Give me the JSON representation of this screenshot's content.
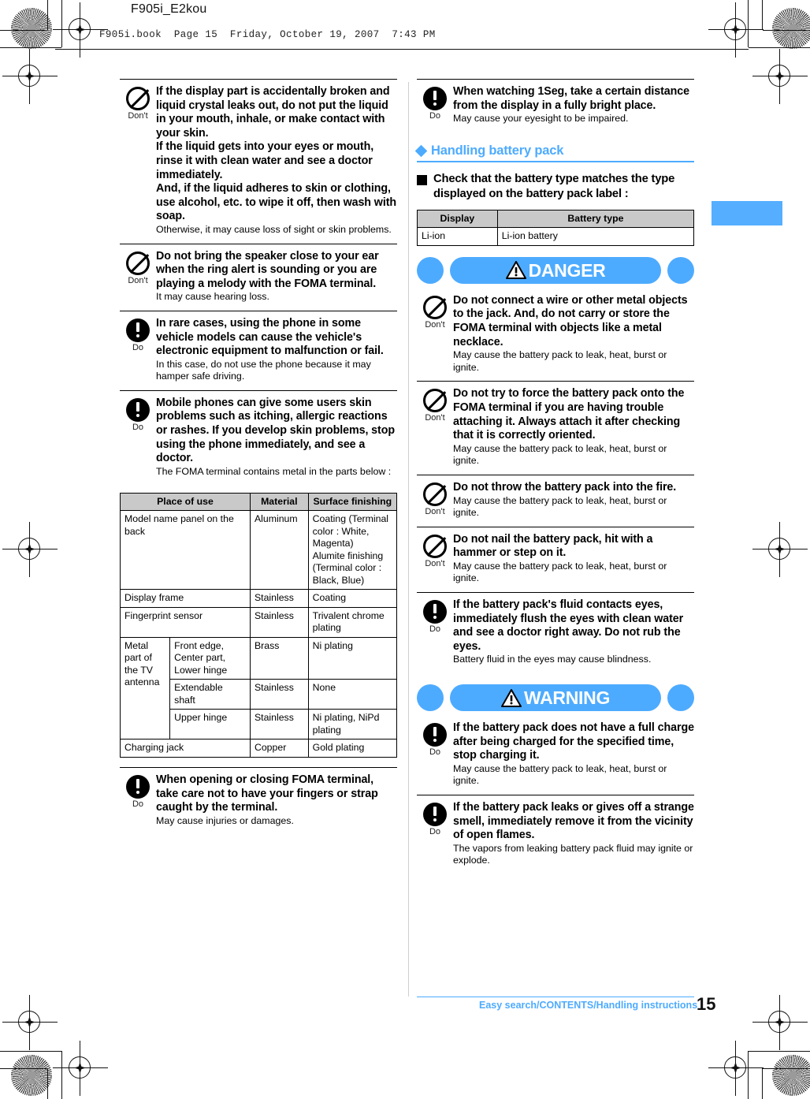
{
  "header": {
    "doc_title": "F905i_E2kou",
    "book_line": "F905i.book  Page 15  Friday, October 19, 2007  7:43 PM"
  },
  "colors": {
    "accent_blue": "#4dabff",
    "tab_blue": "#55aeff",
    "table_header_gray": "#c9c9c9"
  },
  "icons": {
    "dont": "Don't",
    "do": "Do"
  },
  "left_column": {
    "blocks": [
      {
        "icon": "dont",
        "icon_label": "Don't",
        "lead": [
          "If the display part is accidentally broken and liquid crystal leaks out, do not put the liquid in your mouth, inhale, or make contact with your skin.",
          "If the liquid gets into your eyes or mouth, rinse it with clean water and see a doctor immediately.",
          "And, if the liquid adheres to skin or clothing, use alcohol, etc. to wipe it off, then wash with soap."
        ],
        "sub": "Otherwise, it may cause loss of sight or skin problems."
      },
      {
        "icon": "dont",
        "icon_label": "Don't",
        "lead": [
          "Do not bring the speaker close to your ear when the ring alert is sounding or you are playing a melody with the FOMA terminal."
        ],
        "sub": "It may cause hearing loss."
      },
      {
        "icon": "do",
        "icon_label": "Do",
        "lead": [
          "In rare cases, using the phone in some vehicle models can cause the vehicle's electronic equipment to malfunction or fail."
        ],
        "sub": "In this case, do not use the phone because it may hamper safe driving."
      },
      {
        "icon": "do",
        "icon_label": "Do",
        "lead": [
          "Mobile phones can give some users skin problems such as itching, allergic reactions or rashes. If you develop skin problems, stop using the phone immediately, and see a doctor."
        ],
        "sub": "The FOMA terminal contains metal in the parts below :"
      }
    ],
    "metal_table": {
      "headers": [
        "Place of use",
        "Material",
        "Surface finishing"
      ],
      "rows": [
        {
          "place": "Model name panel on the back",
          "place_sub": "",
          "material": "Aluminum",
          "finish": "Coating (Terminal color : White, Magenta)\nAlumite finishing\n (Terminal color : Black, Blue)"
        },
        {
          "place": "Display frame",
          "place_sub": "",
          "material": "Stainless",
          "finish": "Coating"
        },
        {
          "place": "Fingerprint sensor",
          "place_sub": "",
          "material": "Stainless",
          "finish": "Trivalent chrome plating"
        },
        {
          "place": "Metal part of the TV antenna",
          "place_sub": "Front edge, Center part, Lower hinge",
          "material": "Brass",
          "finish": "Ni plating"
        },
        {
          "place": "",
          "place_sub": "Extendable shaft",
          "material": "Stainless",
          "finish": "None"
        },
        {
          "place": "",
          "place_sub": "Upper hinge",
          "material": "Stainless",
          "finish": "Ni plating, NiPd plating"
        },
        {
          "place": "Charging jack",
          "place_sub": "",
          "material": "Copper",
          "finish": "Gold plating"
        }
      ]
    },
    "closing_block": {
      "icon": "do",
      "icon_label": "Do",
      "lead": [
        "When opening or closing FOMA terminal, take care not to have your fingers or strap caught by the terminal."
      ],
      "sub": "May cause injuries or damages."
    }
  },
  "right_column": {
    "top_block": {
      "icon": "do",
      "icon_label": "Do",
      "lead": [
        "When watching 1Seg, take a certain distance from the display in a fully bright place."
      ],
      "sub": "May cause your eyesight to be impaired."
    },
    "section_heading": "Handling battery pack",
    "sub_heading": "Check that the battery type matches the type displayed on the battery pack label :",
    "battery_table": {
      "headers": [
        "Display",
        "Battery type"
      ],
      "rows": [
        [
          "Li-ion",
          "Li-ion battery"
        ]
      ]
    },
    "danger_banner": "DANGER",
    "danger_blocks": [
      {
        "icon": "dont",
        "icon_label": "Don't",
        "lead": [
          "Do not connect a wire or other metal objects to the jack. And, do not carry or store the FOMA terminal with objects like a metal necklace."
        ],
        "sub": "May cause the battery pack to leak, heat, burst or ignite."
      },
      {
        "icon": "dont",
        "icon_label": "Don't",
        "lead": [
          "Do not try to force the battery pack onto the FOMA terminal if you are having trouble attaching it. Always attach it after checking that it is correctly oriented."
        ],
        "sub": "May cause the battery pack to leak, heat, burst or ignite."
      },
      {
        "icon": "dont",
        "icon_label": "Don't",
        "lead": [
          "Do not throw the battery pack into the fire."
        ],
        "sub": "May cause the battery pack to leak, heat, burst or ignite."
      },
      {
        "icon": "dont",
        "icon_label": "Don't",
        "lead": [
          "Do not nail the battery pack, hit with a hammer or step on it."
        ],
        "sub": "May cause the battery pack to leak, heat, burst or ignite."
      },
      {
        "icon": "do",
        "icon_label": "Do",
        "lead": [
          "If the battery pack's fluid contacts eyes, immediately flush the eyes with clean water and see a doctor right away. Do not rub the eyes."
        ],
        "sub": "Battery fluid in the eyes may cause blindness."
      }
    ],
    "warning_banner": "WARNING",
    "warning_blocks": [
      {
        "icon": "do",
        "icon_label": "Do",
        "lead": [
          "If the battery pack does not have a full charge after being charged for the specified time, stop charging it."
        ],
        "sub": "May cause the battery pack to leak, heat, burst or ignite."
      },
      {
        "icon": "do",
        "icon_label": "Do",
        "lead": [
          "If the battery pack leaks or gives off a strange smell, immediately remove it from the vicinity of open flames."
        ],
        "sub": "The vapors from leaking battery pack fluid may ignite or explode."
      }
    ]
  },
  "footer": {
    "text": "Easy search/CONTENTS/Handling instructions",
    "page_number": "15"
  }
}
